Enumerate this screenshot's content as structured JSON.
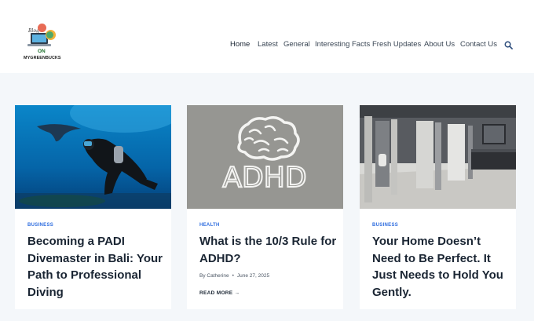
{
  "site": {
    "logo_blog": "Blog",
    "logo_on": "ON",
    "logo_name": "MYGREENBUCKS"
  },
  "nav": {
    "items": [
      "Home",
      "Latest",
      "General",
      "Interesting Facts",
      "Fresh Updates",
      "About Us",
      "Contact Us"
    ],
    "active": "Home"
  },
  "posts": [
    {
      "category": "BUSINESS",
      "title": "Becoming a PADI Divemaster in Bali: Your Path to Professional Diving",
      "image": "scuba-diver-manta-ray"
    },
    {
      "category": "HEALTH",
      "title": "What is the 10/3 Rule for ADHD?",
      "image_text": "ADHD",
      "author": "By Catherine",
      "date": "June 27, 2025",
      "read_more": "READ MORE",
      "image": "brain-chalk-drawing"
    },
    {
      "category": "BUSINESS",
      "title": "Your Home Doesn’t Need to Be Perfect. It Just Needs to Hold You Gently.",
      "image": "modern-bathroom"
    }
  ],
  "colors": {
    "accent": "#2d6cdf",
    "text": "#1a2533",
    "page_bg": "#f4f7fa"
  }
}
